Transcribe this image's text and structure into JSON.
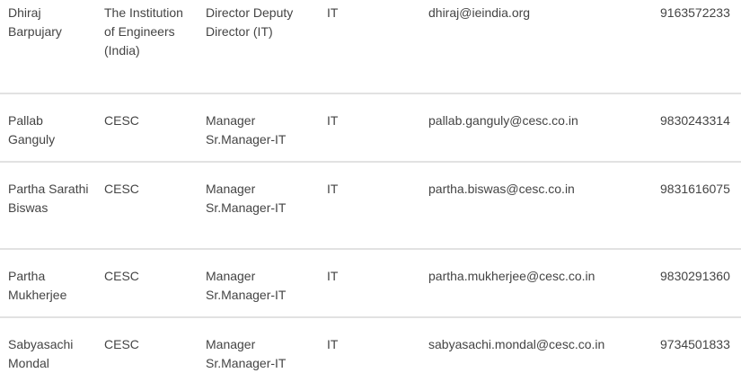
{
  "rows": [
    {
      "name": "Dhiraj Barpujary",
      "organization": "The Institution of Engineers (India)",
      "designation": "Director Deputy Director (IT)",
      "department": "IT",
      "email": "dhiraj@ieindia.org",
      "phone": "9163572233"
    },
    {
      "name": "Pallab Ganguly",
      "organization": "CESC",
      "designation": "Manager Sr.Manager-IT",
      "department": "IT",
      "email": "pallab.ganguly@cesc.co.in",
      "phone": "9830243314"
    },
    {
      "name": "Partha Sarathi Biswas",
      "organization": "CESC",
      "designation": "Manager Sr.Manager-IT",
      "department": "IT",
      "email": "partha.biswas@cesc.co.in",
      "phone": "9831616075"
    },
    {
      "name": "Partha Mukherjee",
      "organization": "CESC",
      "designation": "Manager Sr.Manager-IT",
      "department": "IT",
      "email": "partha.mukherjee@cesc.co.in",
      "phone": "9830291360"
    },
    {
      "name": "Sabyasachi Mondal",
      "organization": "CESC",
      "designation": "Manager Sr.Manager-IT",
      "department": "IT",
      "email": "sabyasachi.mondal@cesc.co.in",
      "phone": "9734501833"
    }
  ]
}
